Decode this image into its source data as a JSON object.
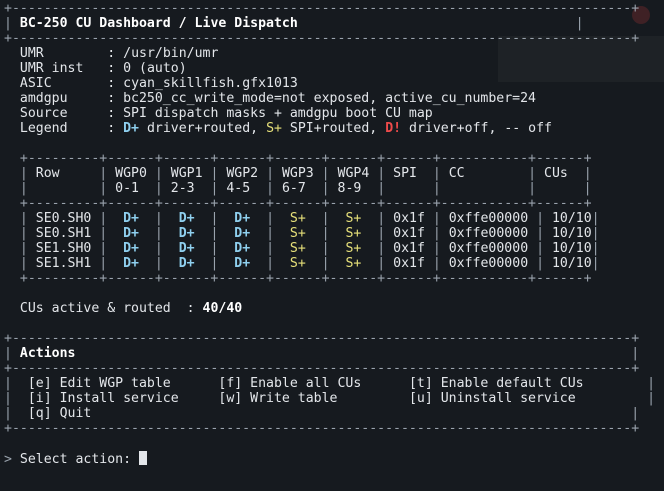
{
  "title": "BC-250 CU Dashboard / Live Dispatch",
  "info": {
    "umr_label": "UMR",
    "umr_value": "/usr/bin/umr",
    "inst_label": "UMR inst",
    "inst_value": "0 (auto)",
    "asic_label": "ASIC",
    "asic_value": "cyan_skillfish.gfx1013",
    "amdgpu_label": "amdgpu",
    "amdgpu_value": "bc250_cc_write_mode=not exposed, active_cu_number=24",
    "source_label": "Source",
    "source_value": "SPI dispatch masks + amdgpu boot CU map",
    "legend_label": "Legend",
    "legend_driver_tag": "D+",
    "legend_driver_text": "driver+routed,",
    "legend_spi_tag": "S+",
    "legend_spi_text": "SPI+routed,",
    "legend_off_tag": "D!",
    "legend_off_text": "driver+off,",
    "legend_none_text": "-- off"
  },
  "table": {
    "headers": {
      "row": "Row",
      "wgp0": "WGP0",
      "wgp0_sub": "0-1",
      "wgp1": "WGP1",
      "wgp1_sub": "2-3",
      "wgp2": "WGP2",
      "wgp2_sub": "4-5",
      "wgp3": "WGP3",
      "wgp3_sub": "6-7",
      "wgp4": "WGP4",
      "wgp4_sub": "8-9",
      "spi": "SPI",
      "cc": "CC",
      "cus": "CUs"
    },
    "rows": [
      {
        "name": "SE0.SH0",
        "w0": "D+",
        "w1": "D+",
        "w2": "D+",
        "w3": "S+",
        "w4": "S+",
        "spi": "0x1f",
        "cc": "0xffe00000",
        "cus": "10/10"
      },
      {
        "name": "SE0.SH1",
        "w0": "D+",
        "w1": "D+",
        "w2": "D+",
        "w3": "S+",
        "w4": "S+",
        "spi": "0x1f",
        "cc": "0xffe00000",
        "cus": "10/10"
      },
      {
        "name": "SE1.SH0",
        "w0": "D+",
        "w1": "D+",
        "w2": "D+",
        "w3": "S+",
        "w4": "S+",
        "spi": "0x1f",
        "cc": "0xffe00000",
        "cus": "10/10"
      },
      {
        "name": "SE1.SH1",
        "w0": "D+",
        "w1": "D+",
        "w2": "D+",
        "w3": "S+",
        "w4": "S+",
        "spi": "0x1f",
        "cc": "0xffe00000",
        "cus": "10/10"
      }
    ]
  },
  "summary": {
    "label": "CUs active & routed",
    "value": "40/40"
  },
  "actions": {
    "title": "Actions",
    "edit": "[e] Edit WGP table",
    "enable_all": "[f] Enable all CUs",
    "enable_default": "[t] Enable default CUs",
    "install": "[i] Install service",
    "write": "[w] Write table",
    "uninstall": "[u] Uninstall service",
    "quit": "[q] Quit"
  },
  "prompt": {
    "marker": ">",
    "text": "Select action:"
  },
  "colors": {
    "driver": "#8fd0ef",
    "spi": "#e6e07a",
    "off": "#ef4b4b",
    "background": "#161a1f"
  }
}
